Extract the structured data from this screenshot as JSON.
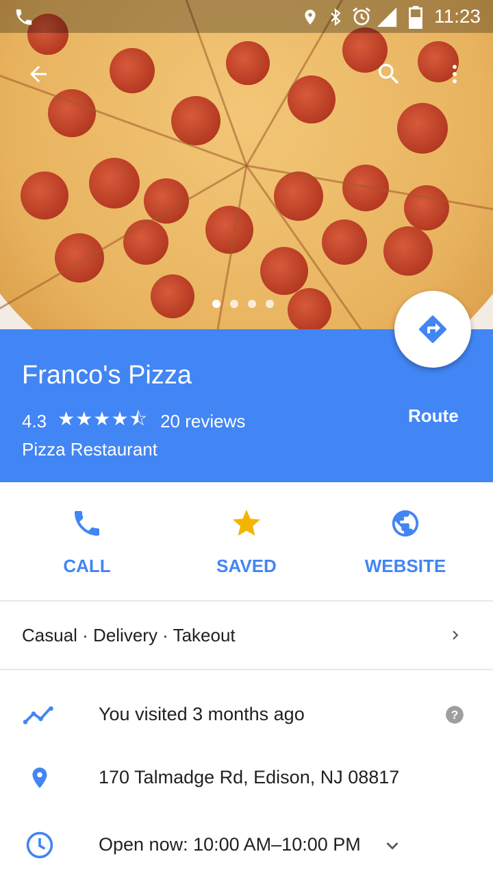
{
  "status_bar": {
    "time": "11:23"
  },
  "hero": {
    "active_photo_index": 0,
    "photo_count": 4
  },
  "place": {
    "name": "Franco's Pizza",
    "rating": "4.3",
    "stars": "★★★★⯪",
    "reviews": "20 reviews",
    "category": "Pizza Restaurant",
    "route_label": "Route"
  },
  "actions": {
    "call": "CALL",
    "saved": "SAVED",
    "website": "WEBSITE"
  },
  "features": "Casual · Delivery · Takeout",
  "details": {
    "visited": "You visited 3 months ago",
    "address": "170 Talmadge Rd, Edison, NJ 08817",
    "hours": "Open now: 10:00 AM–10:00 PM"
  },
  "colors": {
    "primary": "#4285f4",
    "saved_star": "#f4b400",
    "muted": "#9e9e9e"
  }
}
